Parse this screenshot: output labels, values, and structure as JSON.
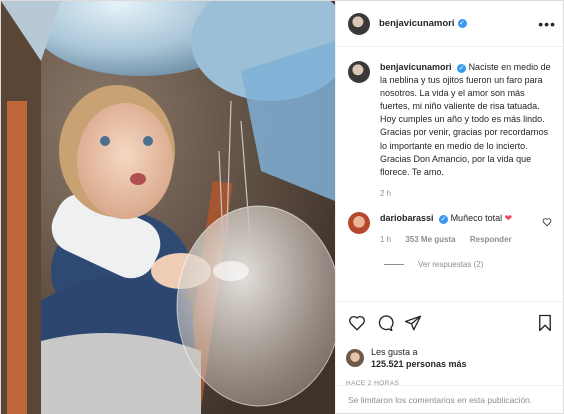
{
  "header": {
    "username": "benjavicunamori",
    "more_label": "•••"
  },
  "caption": {
    "username": "benjavicunamori",
    "text": "Naciste en medio de la neblina y tus ojitos fueron un faro para nosotros. La vida y el amor son más fuertes, mi niño valiente de risa tatuada. Hoy cumples un año y todo es más lindo. Gracias por venir, gracias por recordarnos lo importante en medio de lo incierto. Gracias Don Amancio, por la vida que florece. Te amo.",
    "time": "2 h"
  },
  "comment": {
    "username": "dariobarassi",
    "text": "Muñeco total",
    "time": "1 h",
    "likes": "353 Me gusta",
    "reply_label": "Responder",
    "view_replies": "Ver respuestas (2)"
  },
  "likes": {
    "line1": "Les gusta a",
    "line2": "125.521 personas más"
  },
  "timestamp": "HACE 2 HORAS",
  "footer": "Se limitaron los comentarios en esta publicación.",
  "icons": [
    "more-icon",
    "verified-icon",
    "heart-icon",
    "comment-icon",
    "share-icon",
    "bookmark-icon",
    "red-heart-emoji"
  ],
  "colors": {
    "verified": "#3897f0",
    "link_gray": "#8e8e8e",
    "border": "#dbdbdb",
    "emoji_heart": "#ed4956"
  }
}
